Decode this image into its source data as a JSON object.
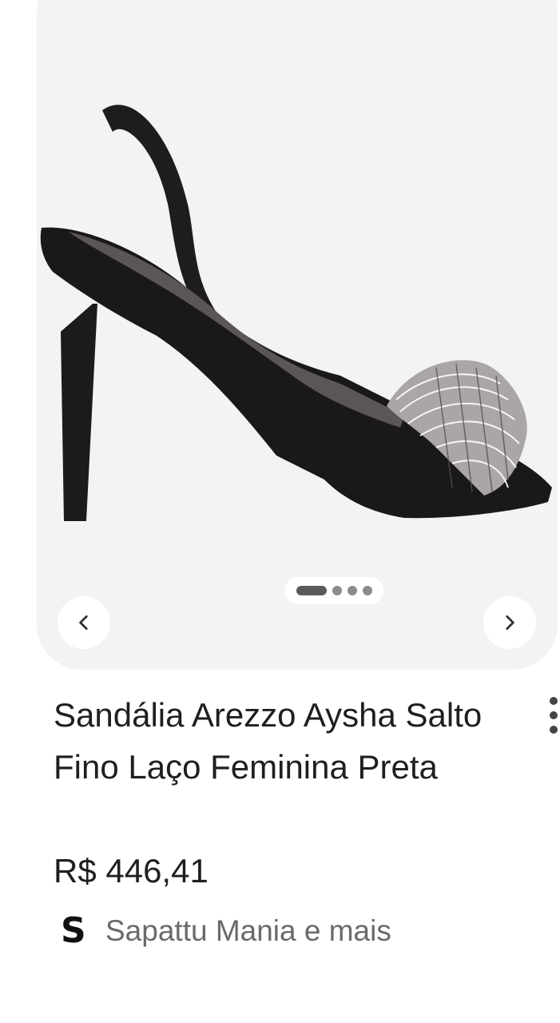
{
  "product": {
    "title": "Sandália Arezzo Aysha Salto Fino Laço Feminina Preta",
    "price": "R$ 446,41",
    "seller_logo_letter": "S",
    "seller": "Sapattu Mania e mais"
  },
  "carousel": {
    "image_count": 4,
    "active_index": 0,
    "prev_icon": "chevron-left-icon",
    "next_icon": "chevron-right-icon"
  },
  "colors": {
    "card_background": "#f3f3f3",
    "text_primary": "#1f1f1f",
    "text_secondary": "#6a6a6a"
  }
}
